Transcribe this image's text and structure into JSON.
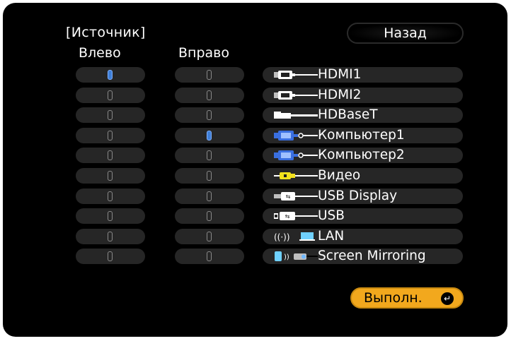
{
  "header": {
    "title": "[Источник]",
    "back_label": "Назад"
  },
  "columns": {
    "left_label": "Влево",
    "right_label": "Вправо"
  },
  "sources": [
    {
      "label": "HDMI1",
      "icon": "hdmi-icon"
    },
    {
      "label": "HDMI2",
      "icon": "hdmi-icon"
    },
    {
      "label": "HDBaseT",
      "icon": "hdbaset-icon"
    },
    {
      "label": "Компьютер1",
      "icon": "computer-vga-icon"
    },
    {
      "label": "Компьютер2",
      "icon": "computer-vga-icon"
    },
    {
      "label": "Видео",
      "icon": "video-rca-icon"
    },
    {
      "label": "USB Display",
      "icon": "usb-display-icon"
    },
    {
      "label": "USB",
      "icon": "usb-icon"
    },
    {
      "label": "LAN",
      "icon": "lan-icon"
    },
    {
      "label": "Screen Mirroring",
      "icon": "screen-mirroring-icon"
    }
  ],
  "left_selected_index": 0,
  "right_selected_index": 3,
  "footer": {
    "execute_label": "Выполн."
  },
  "colors": {
    "selected_knob": "#3f7fd8",
    "execute_button": "#f2a81d",
    "video_icon": "#f2e11d",
    "vga_icon": "#3a6fe0"
  }
}
